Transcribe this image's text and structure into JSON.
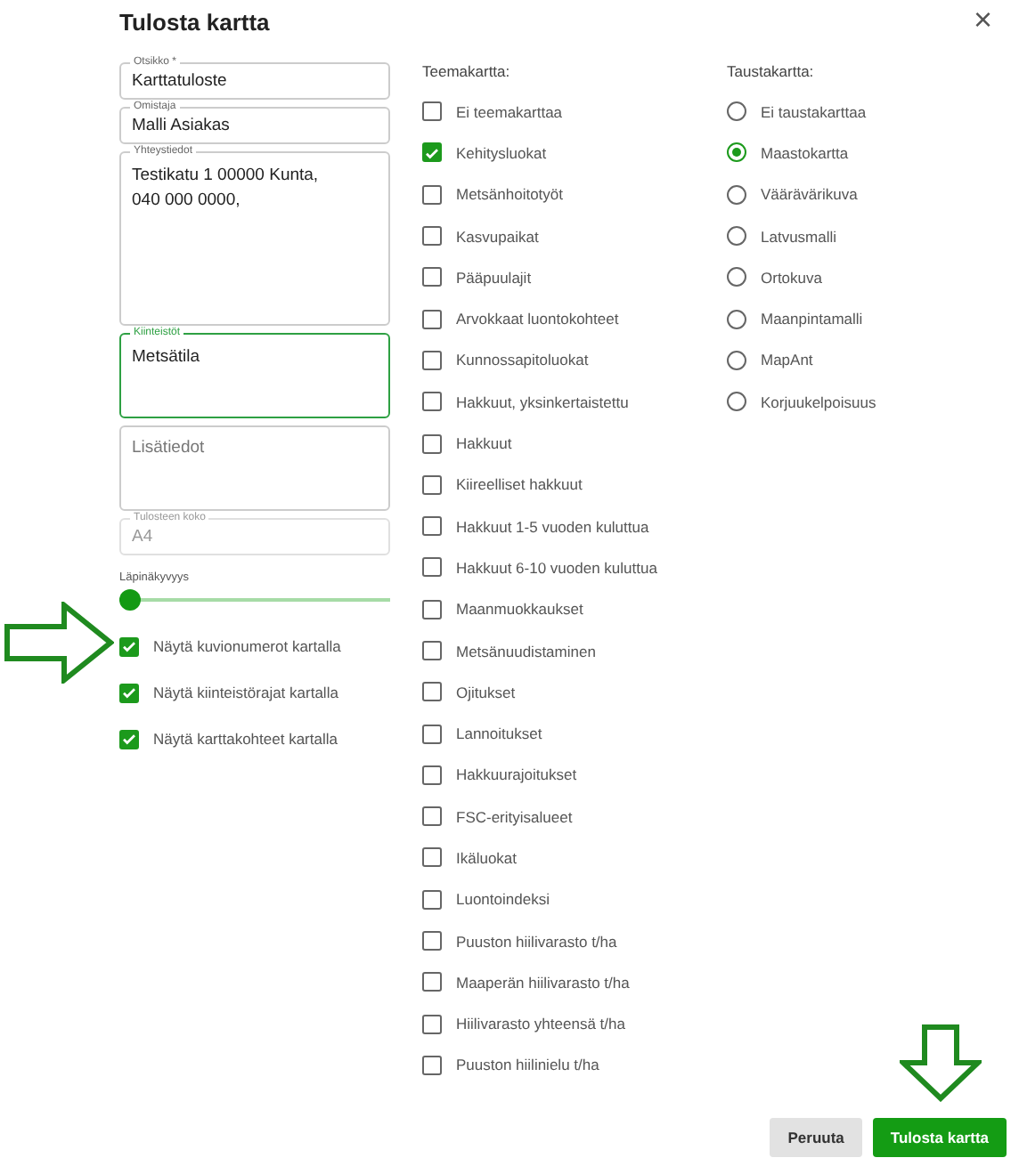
{
  "dialog": {
    "title": "Tulosta kartta",
    "close": "×"
  },
  "fields": [
    {
      "label": "Otsikko *",
      "value": "Karttatuloste",
      "kind": "input",
      "focused": false,
      "disabled": false
    },
    {
      "label": "Omistaja",
      "value": "Malli Asiakas",
      "kind": "input",
      "focused": false,
      "disabled": false
    },
    {
      "label": "Yhteystiedot",
      "value": "Testikatu 1 00000 Kunta,\n040 000 0000,",
      "kind": "textarea",
      "focused": false,
      "disabled": false
    },
    {
      "label": "Kiinteistöt",
      "value": "Metsätila",
      "kind": "textarea",
      "focused": true,
      "disabled": false
    },
    {
      "placeholder": "Lisätiedot",
      "kind": "textarea",
      "focused": false,
      "disabled": false
    },
    {
      "label": "Tulosteen koko",
      "value": "A4",
      "kind": "input",
      "focused": false,
      "disabled": true
    }
  ],
  "slider": {
    "label": "Läpinäkyvyys",
    "level": 0
  },
  "options": [
    {
      "label": "Näytä kuvionumerot kartalla",
      "checked": true
    },
    {
      "label": "Näytä kiinteistörajat kartalla",
      "checked": true
    },
    {
      "label": "Näytä karttakohteet kartalla",
      "checked": true
    }
  ],
  "theme_map": {
    "heading": "Teemakartta:",
    "items": [
      {
        "label": "Ei teemakarttaa",
        "checked": false
      },
      {
        "label": "Kehitysluokat",
        "checked": true
      },
      {
        "label": "Metsänhoitotyöt",
        "checked": false
      },
      {
        "label": "Kasvupaikat",
        "checked": false
      },
      {
        "label": "Pääpuulajit",
        "checked": false
      },
      {
        "label": "Arvokkaat luontokohteet",
        "checked": false
      },
      {
        "label": "Kunnossapitoluokat",
        "checked": false
      },
      {
        "label": "Hakkuut, yksinkertaistettu",
        "checked": false
      },
      {
        "label": "Hakkuut",
        "checked": false
      },
      {
        "label": "Kiireelliset hakkuut",
        "checked": false
      },
      {
        "label": "Hakkuut 1-5 vuoden kuluttua",
        "checked": false
      },
      {
        "label": "Hakkuut 6-10 vuoden kuluttua",
        "checked": false
      },
      {
        "label": "Maanmuokkaukset",
        "checked": false
      },
      {
        "label": "Metsänuudistaminen",
        "checked": false
      },
      {
        "label": "Ojitukset",
        "checked": false
      },
      {
        "label": "Lannoitukset",
        "checked": false
      },
      {
        "label": "Hakkuurajoitukset",
        "checked": false
      },
      {
        "label": "FSC-erityisalueet",
        "checked": false
      },
      {
        "label": "Ikäluokat",
        "checked": false
      },
      {
        "label": "Luontoindeksi",
        "checked": false
      },
      {
        "label": "Puuston hiilivarasto t/ha",
        "checked": false
      },
      {
        "label": "Maaperän hiilivarasto t/ha",
        "checked": false
      },
      {
        "label": "Hiilivarasto yhteensä t/ha",
        "checked": false
      },
      {
        "label": "Puuston hiilinielu t/ha",
        "checked": false
      }
    ]
  },
  "background_map": {
    "heading": "Taustakartta:",
    "items": [
      {
        "label": "Ei taustakarttaa",
        "selected": false
      },
      {
        "label": "Maastokartta",
        "selected": true
      },
      {
        "label": "Väärävärikuva",
        "selected": false
      },
      {
        "label": "Latvusmalli",
        "selected": false
      },
      {
        "label": "Ortokuva",
        "selected": false
      },
      {
        "label": "Maanpintamalli",
        "selected": false
      },
      {
        "label": "MapAnt",
        "selected": false
      },
      {
        "label": "Korjuukelpoisuus",
        "selected": false
      }
    ]
  },
  "buttons": [
    {
      "label": "Peruuta",
      "kind": "secondary"
    },
    {
      "label": "Tulosta kartta",
      "kind": "primary"
    }
  ]
}
